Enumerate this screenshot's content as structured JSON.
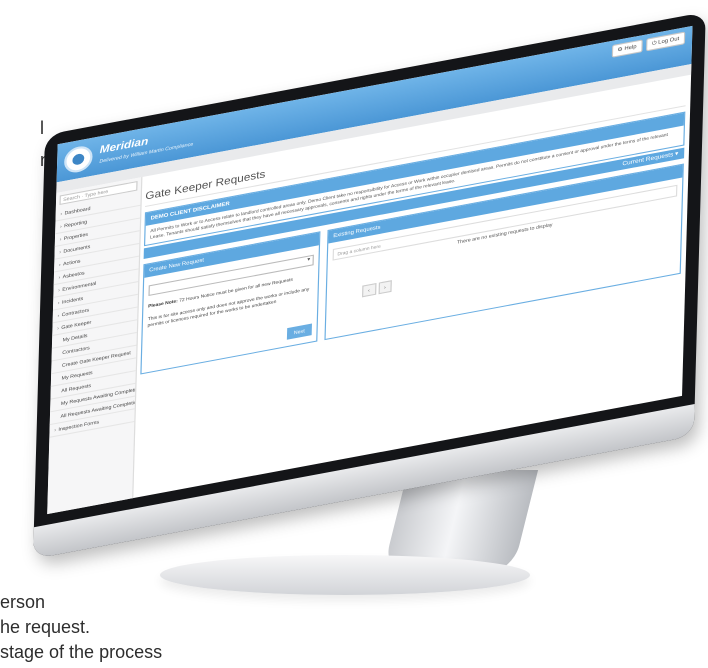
{
  "background_text": {
    "line1": "l",
    "line2": "nd",
    "line3": "erson",
    "line4": "he request.",
    "line5": "stage of the process"
  },
  "app": {
    "brand": "Meridian",
    "brand_sub": "Delivered by William Martin Compliance",
    "help_label": "Help",
    "logout_label": "Log Out"
  },
  "sidebar": {
    "search_placeholder": "Search · Type here",
    "items": [
      {
        "label": "Dashboard",
        "caret": true
      },
      {
        "label": "Reporting",
        "caret": true
      },
      {
        "label": "Properties",
        "caret": true
      },
      {
        "label": "Documents",
        "caret": true
      },
      {
        "label": "Actions",
        "caret": true
      },
      {
        "label": "Asbestos",
        "caret": true
      },
      {
        "label": "Environmental",
        "caret": true
      },
      {
        "label": "Incidents",
        "caret": true
      },
      {
        "label": "Contractors",
        "caret": true
      },
      {
        "label": "Gate Keeper",
        "caret": true
      },
      {
        "label": "My Details",
        "caret": false
      },
      {
        "label": "Contractors",
        "caret": false
      },
      {
        "label": "Create Gate Keeper Request",
        "caret": false
      },
      {
        "label": "My Requests",
        "caret": false
      },
      {
        "label": "All Requests",
        "caret": false
      },
      {
        "label": "My Requests Awaiting Completion",
        "caret": false
      },
      {
        "label": "All Requests Awaiting Completion",
        "caret": false
      },
      {
        "label": "Inspection Forms",
        "caret": true
      }
    ]
  },
  "main": {
    "title": "Gate Keeper Requests",
    "disclaimer_title": "DEMO CLIENT DISCLAIMER",
    "disclaimer_text": "All Permits to Work or to Access relate to landlord controlled areas only. Demo Client take no responsibility for Access or Work within occupier demised areas. Permits do not constitute a consent or approval under the terms of the relevant Lease. Tenants should satisfy themselves that they have all necessary approvals, consents and rights under the terms of the relevant lease.",
    "current_tab": "Current Requests",
    "create_title": "Create New Request",
    "note_bold": "Please Note:",
    "note_text": "72 Hours Notice must be given for all new Requests",
    "note_text2": "This is for site access only and does not approve the works or include any permits or licences required for the works to be undertaken",
    "next_label": "Next",
    "existing_title": "Existing Requests",
    "drag_hint": "Drag a column here",
    "empty_msg": "There are no existing requests to display",
    "pager_prev": "‹",
    "pager_next": "›"
  }
}
